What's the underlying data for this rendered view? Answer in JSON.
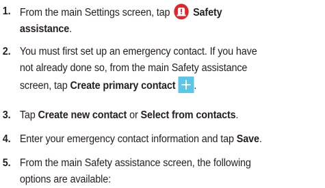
{
  "steps": [
    {
      "number": "1.",
      "line1_before": "From the main Settings screen, tap",
      "line1_bold": "Safety",
      "line2_bold": "assistance",
      "line2_after": "."
    },
    {
      "number": "2.",
      "line1": "You must first set up an emergency contact. If you have",
      "line2": "not already done so, from the main Safety assistance",
      "line3_before": "screen, tap",
      "line3_bold": "Create primary contact",
      "line3_after": "."
    },
    {
      "number": "3.",
      "text1": "Tap",
      "bold1": "Create new contact",
      "text2": "or",
      "bold2": "Select from contacts",
      "text3": "."
    },
    {
      "number": "4.",
      "text1": "Enter your emergency contact information and tap",
      "bold1": "Save",
      "text2": "."
    },
    {
      "number": "5.",
      "line1": "From the main Safety assistance screen, the following",
      "line2": "options are available:"
    }
  ],
  "icons": {
    "safety_icon": "alert-icon",
    "safety_icon_color": "#e0262b",
    "add_icon": "plus-icon",
    "add_icon_color": "#5bc6e8"
  }
}
